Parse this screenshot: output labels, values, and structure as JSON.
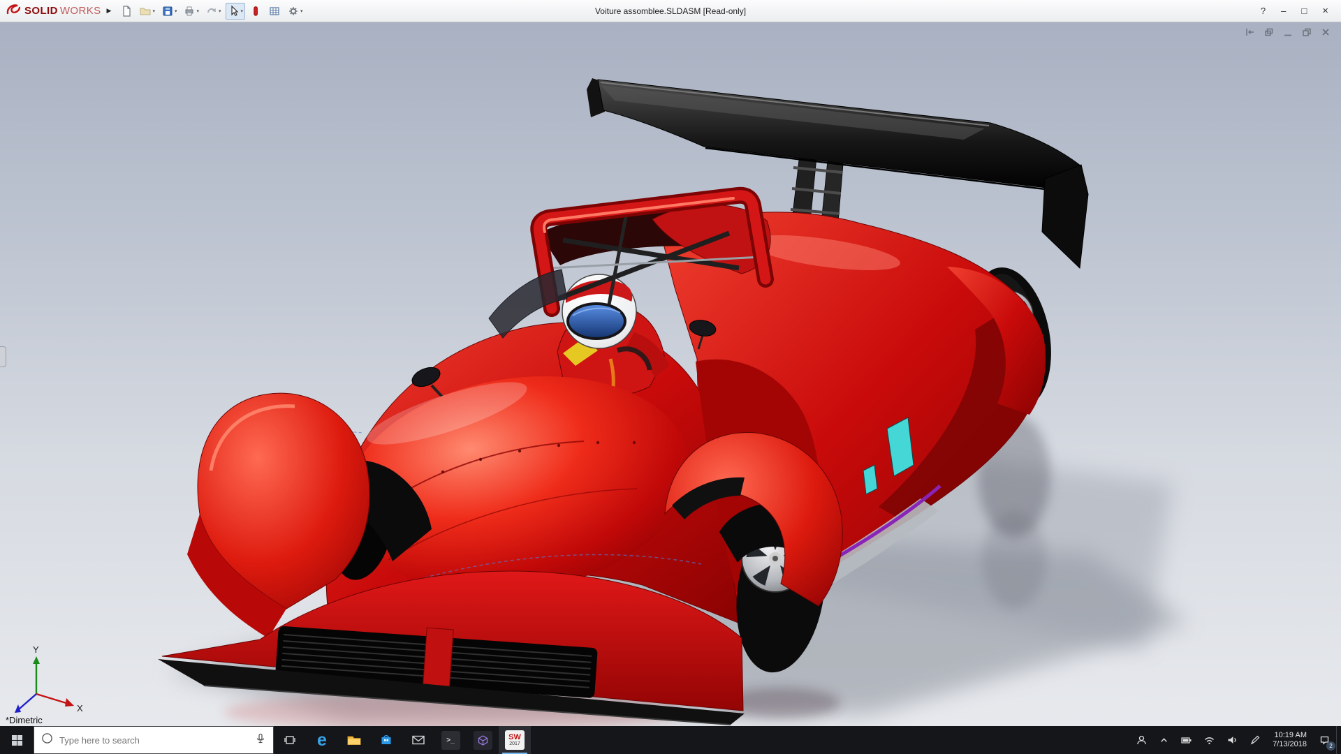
{
  "colors": {
    "car_red": "#d01212",
    "accent_blue": "#76b9ed",
    "taskbar_bg": "#15161a",
    "title_bar_bg": "#f4f5f6",
    "viewport_top": "#a9b1c2",
    "viewport_bottom": "#e7e9ed"
  },
  "title_bar": {
    "brand_bold": "SOLID",
    "brand_light": "WORKS",
    "menu_arrow": "▶",
    "title": "Voiture assomblee.SLDASM [Read-only]",
    "help_label": "?",
    "minimize_label": "–",
    "maximize_label": "□",
    "close_label": "×"
  },
  "toolbar": {
    "caret": "▾",
    "icons": [
      "new-document",
      "open",
      "save",
      "print",
      "undo",
      "select",
      "rebuild",
      "file-properties",
      "options"
    ]
  },
  "viewport": {
    "view_label": "*Dimetric",
    "axis_x": "X",
    "axis_y": "Y"
  },
  "taskbar": {
    "search_placeholder": "Type here to search",
    "edge_letter": "e",
    "console_glyph": ">_",
    "sw_icon_text": "SW",
    "sw_icon_year": "2017",
    "time": "10:19 AM",
    "date": "7/13/2018",
    "notification_count": "2"
  }
}
